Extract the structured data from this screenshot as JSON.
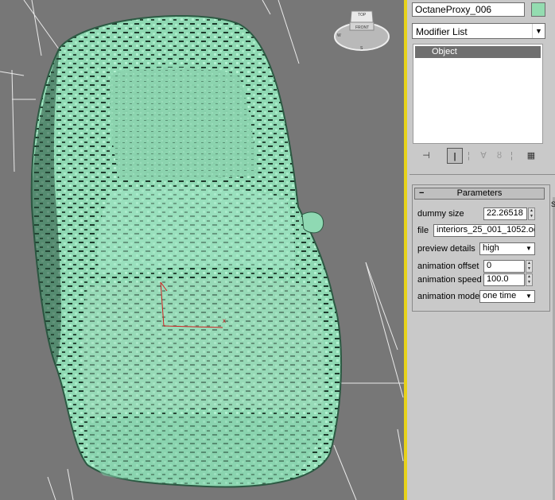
{
  "viewport": {
    "viewcube": {
      "top": "TOP",
      "front": "FRONT",
      "compass": [
        "W",
        "S"
      ]
    }
  },
  "panel": {
    "object_name": "OctaneProxy_006",
    "object_color": "#93dcb0",
    "modifier_list": "Modifier List",
    "stack_items": [
      "Object"
    ],
    "toolbar": {
      "pin_icon": "pin-stack-icon",
      "show_end_icon": "show-end-result-icon",
      "unique_icon": "make-unique-icon",
      "remove_icon": "remove-modifier-icon",
      "configure_icon": "configure-modifier-sets-icon"
    },
    "rollout": {
      "title": "Parameters",
      "toggle": "−",
      "dummy_size_label": "dummy size",
      "dummy_size_value": "22.26518",
      "file_label": "file",
      "file_value": "interiors_25_001_1052.oc",
      "preview_details_label": "preview details",
      "preview_details_value": "high",
      "animation_offset_label": "animation offset",
      "animation_offset_value": "0",
      "animation_speed_label": "animation speed",
      "animation_speed_value": "100.0",
      "animation_mode_label": "animation mode",
      "animation_mode_value": "one time"
    },
    "edge_mark": "S"
  }
}
